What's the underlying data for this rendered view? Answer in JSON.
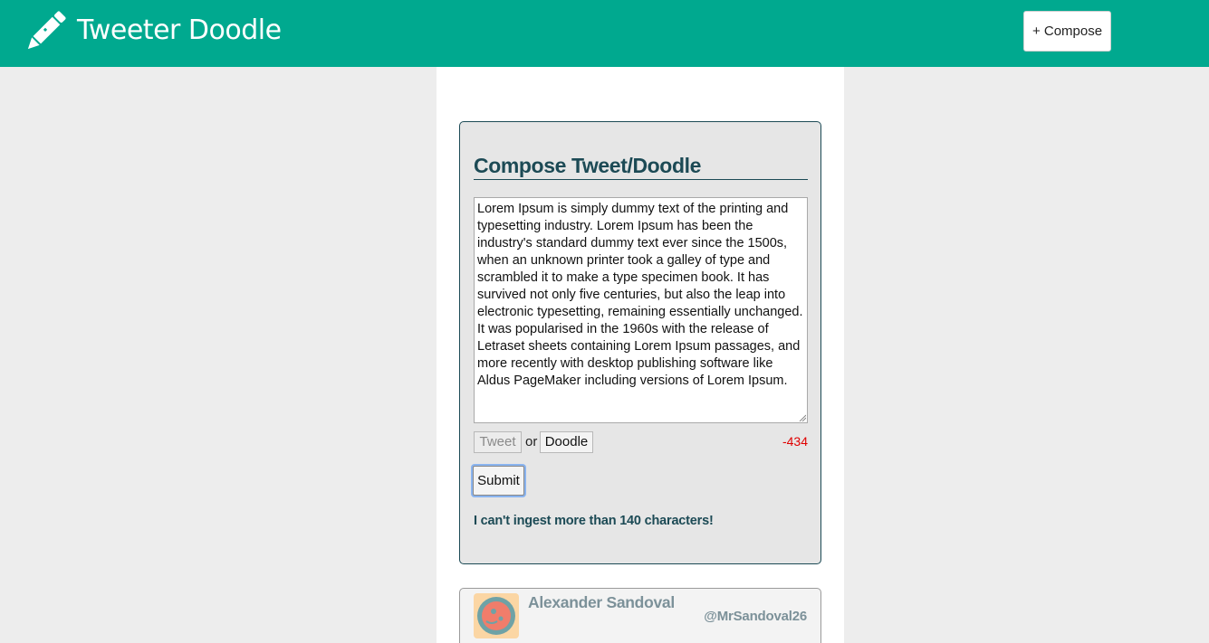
{
  "header": {
    "brand": "Tweeter Doodle",
    "compose_label": "+ Compose",
    "logo_icon": "pencil-icon",
    "background_color": "#00a98f"
  },
  "compose": {
    "title": "Compose Tweet/Doodle",
    "text": "Lorem Ipsum is simply dummy text of the printing and typesetting industry. Lorem Ipsum has been the industry's standard dummy text ever since the 1500s, when an unknown printer took a galley of type and scrambled it to make a type specimen book. It has survived not only five centuries, but also the leap into electronic typesetting, remaining essentially unchanged. It was popularised in the 1960s with the release of Letraset sheets containing Lorem Ipsum passages, and more recently with desktop publishing software like Aldus PageMaker including versions of Lorem Ipsum.",
    "mode_tweet_label": "Tweet",
    "mode_separator": "or",
    "mode_doodle_label": "Doodle",
    "selected_mode": "Tweet",
    "char_count": "-434",
    "submit_label": "Submit",
    "warning": "I can't ingest more than 140 characters!",
    "accent_color": "#1c4a55",
    "error_color": "#e00000"
  },
  "tweets": [
    {
      "author_name": "Alexander Sandoval",
      "author_handle": "@MrSandoval26",
      "avatar_icon": "avatar-icon"
    }
  ]
}
